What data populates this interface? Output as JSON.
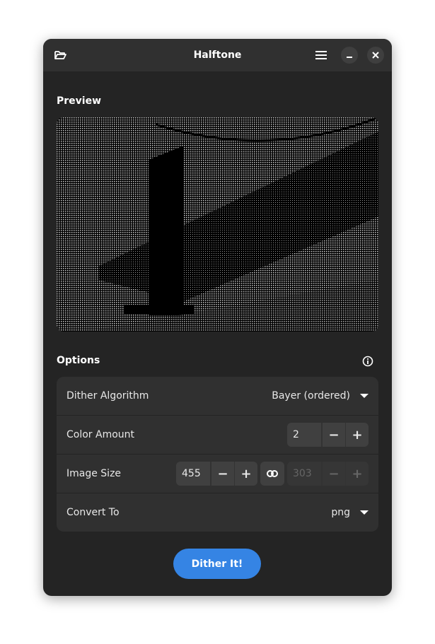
{
  "header": {
    "title": "Halftone",
    "open_icon": "folder-open-icon",
    "menu_icon": "hamburger-menu-icon",
    "minimize_icon": "minimize-icon",
    "close_icon": "close-icon"
  },
  "preview": {
    "title": "Preview"
  },
  "options": {
    "title": "Options",
    "info_icon": "info-icon",
    "dither_algorithm": {
      "label": "Dither Algorithm",
      "value": "Bayer (ordered)"
    },
    "color_amount": {
      "label": "Color Amount",
      "value": "2"
    },
    "image_size": {
      "label": "Image Size",
      "width": "455",
      "height": "303"
    },
    "convert_to": {
      "label": "Convert To",
      "value": "png"
    }
  },
  "action": {
    "label": "Dither It!"
  },
  "colors": {
    "accent": "#3584e4",
    "window": "#242424",
    "header": "#303030"
  }
}
